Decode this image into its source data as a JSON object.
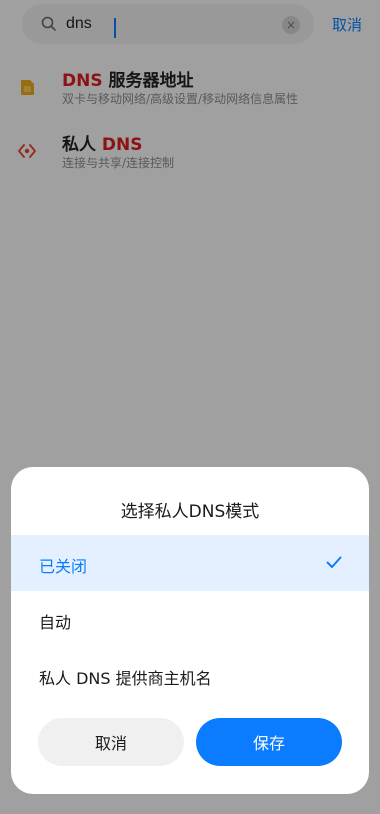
{
  "search": {
    "query": "dns",
    "clear_glyph": "×",
    "cancel_label": "取消"
  },
  "results": [
    {
      "icon": "sim-card-icon",
      "title_highlight": "DNS",
      "title_rest": " 服务器地址",
      "path": "双卡与移动网络/高级设置/移动网络信息属性"
    },
    {
      "icon": "private-dns-icon",
      "title_prefix": "私人 ",
      "title_highlight": "DNS",
      "path": "连接与共享/连接控制"
    }
  ],
  "dialog": {
    "title": "选择私人DNS模式",
    "options": [
      {
        "label": "已关闭",
        "selected": true
      },
      {
        "label": "自动",
        "selected": false
      },
      {
        "label": "私人 DNS 提供商主机名",
        "selected": false
      }
    ],
    "cancel_label": "取消",
    "save_label": "保存"
  },
  "colors": {
    "accent": "#0b7cff",
    "highlight": "#d81e1e",
    "selected_bg": "#e4f0ff"
  }
}
